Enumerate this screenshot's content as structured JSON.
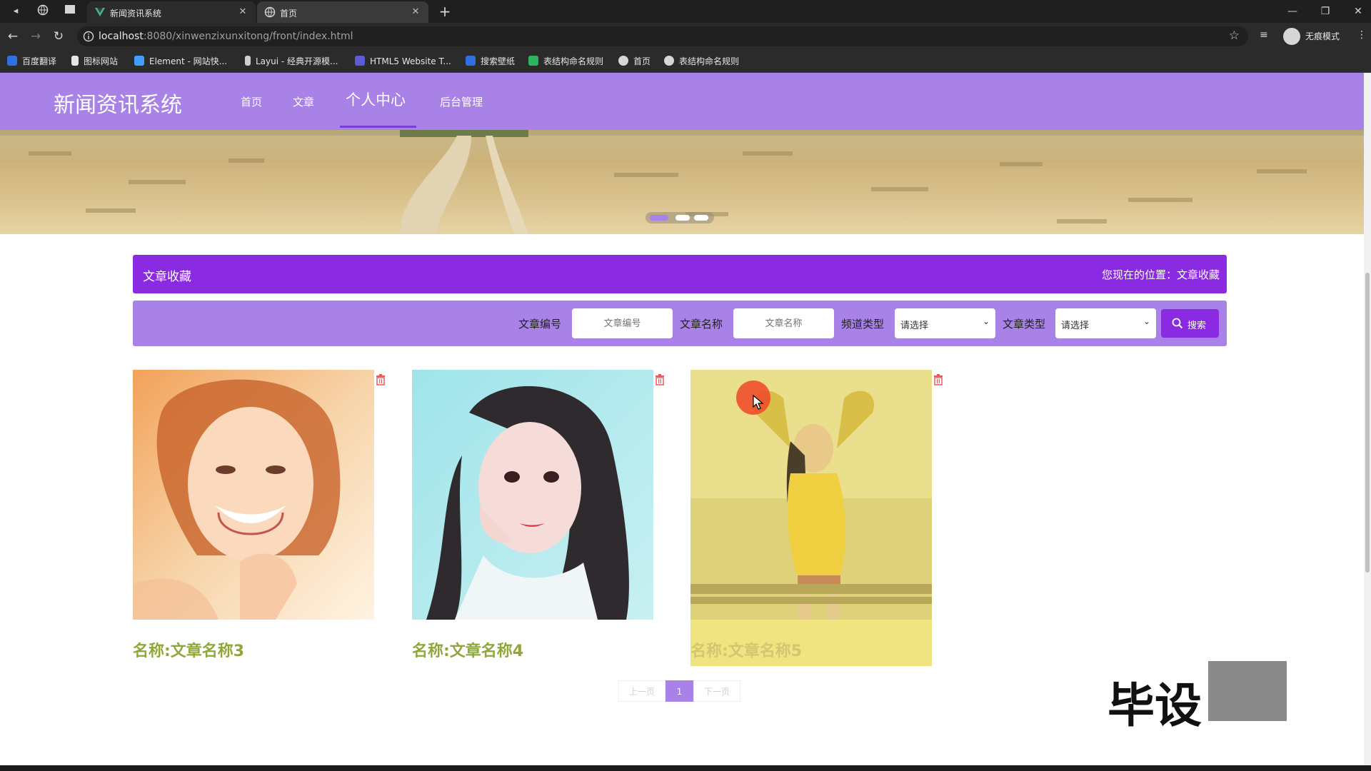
{
  "browser": {
    "tabs": [
      {
        "title": "新闻资讯系统",
        "active": false
      },
      {
        "title": "首页",
        "active": true
      }
    ],
    "url_host": "localhost",
    "url_rest": ":8080/xinwenzixunxitong/front/index.html",
    "profile_label": "无痕模式",
    "bookmarks": [
      "百度翻译",
      "图标网站",
      "Element - 网站快...",
      "Layui - 经典开源模...",
      "HTML5 Website T...",
      "搜索壁纸",
      "表结构命名规则",
      "首页",
      "表结构命名规则"
    ]
  },
  "site": {
    "logo": "新闻资讯系统",
    "nav": [
      "首页",
      "文章",
      "个人中心",
      "后台管理"
    ],
    "active_nav": "个人中心",
    "theme": {
      "primary": "#a882e6",
      "accent": "#8a2be2",
      "title_green": "#8fa83a"
    }
  },
  "banner": {
    "slides": 3,
    "active_slide": 1
  },
  "breadcrumb": {
    "title": "文章收藏",
    "location": "您现在的位置：文章收藏"
  },
  "search": {
    "fields": [
      {
        "label": "文章编号",
        "placeholder": "文章编号"
      },
      {
        "label": "文章名称",
        "placeholder": "文章名称"
      }
    ],
    "selects": [
      {
        "label": "频道类型",
        "value": "请选择"
      },
      {
        "label": "文章类型",
        "value": "请选择"
      }
    ],
    "button_label": "搜索"
  },
  "cards": [
    {
      "name": "名称:文章名称3"
    },
    {
      "name": "名称:文章名称4"
    },
    {
      "name": "名称:文章名称5"
    }
  ],
  "pagination": {
    "prev": "上一页",
    "current": "1",
    "next": "下一页"
  },
  "watermark": "毕设"
}
